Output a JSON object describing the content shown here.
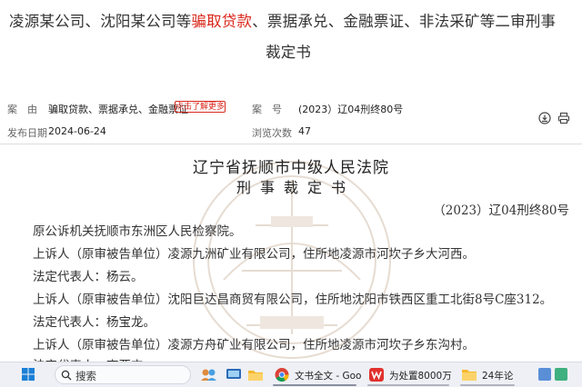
{
  "title": {
    "line1_before": "凌源某公司、沈阳某公司等",
    "line1_highlight": "骗取贷款",
    "line1_after": "、票据承兑、金融票证、非法采矿等二审刑事",
    "line2": "裁定书"
  },
  "meta": {
    "cause_label": "案　由",
    "cause_value": "骗取贷款、票据承兑、金融票证",
    "more_button": "点击了解更多",
    "case_no_label": "案　号",
    "case_no_value": "(2023）辽04刑终80号",
    "publish_label": "发布日期",
    "publish_value": "2024-06-24",
    "views_label": "浏览次数",
    "views_value": "47"
  },
  "document": {
    "court_name": "辽宁省抚顺市中级人民法院",
    "doc_type": "刑事裁定书",
    "case_number": "（2023）辽04刑终80号",
    "paragraphs": [
      "原公诉机关抚顺市东洲区人民检察院。",
      "上诉人（原审被告单位）凌源九洲矿业有限公司，住所地凌源市河坎子乡大河西。",
      "法定代表人：杨云。",
      "上诉人（原审被告单位）沈阳巨达昌商贸有限公司，住所地沈阳市铁西区重工北街8号C座312。",
      "法定代表人：杨宝龙。",
      "上诉人（原审被告单位）凌源方舟矿业有限公司，住所地凌源市河坎子乡东沟村。",
      "法定代表人：李亚杰。"
    ]
  },
  "taskbar": {
    "search_placeholder": "搜索",
    "chrome_label": "文书全文 - Goo",
    "wps_label": "为处置8000万",
    "folder_label": "24年论"
  },
  "colors": {
    "highlight": "#d9281c",
    "taskbar": "#eef0f5"
  }
}
